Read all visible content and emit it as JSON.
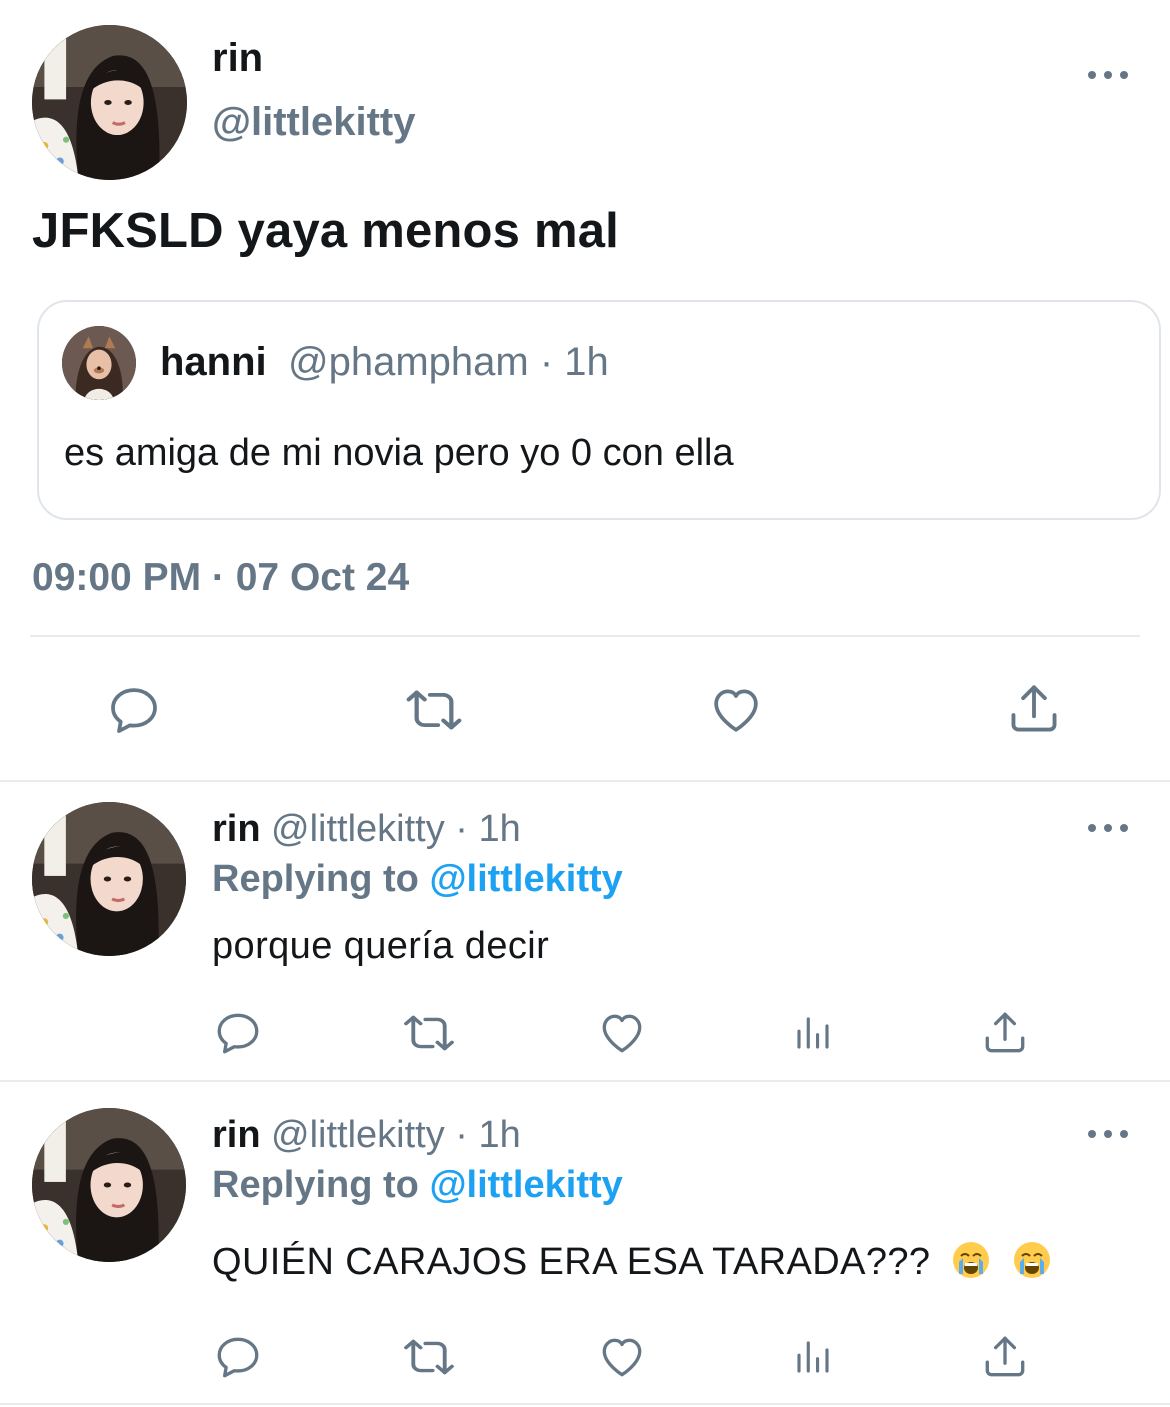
{
  "main_tweet": {
    "name": "rin",
    "handle": "@littlekitty",
    "text": "JFKSLD yaya menos mal",
    "datetime": "09:00 PM · 07 Oct 24",
    "quote": {
      "name": "hanni",
      "handle": "@phampham · 1h",
      "text": "es amiga de mi novia pero yo 0 con ella"
    }
  },
  "replies": [
    {
      "name": "rin",
      "handle": "@littlekitty · 1h",
      "replying_prefix": "Replying to",
      "replying_to": "@littlekitty",
      "text": "porque quería decir"
    },
    {
      "name": "rin",
      "handle": "@littlekitty · 1h",
      "replying_prefix": "Replying to",
      "replying_to": "@littlekitty",
      "text": "QUIÉN CARAJOS ERA ESA TARADA???",
      "emojis": [
        "loudly-crying-face",
        "loudly-crying-face"
      ]
    }
  ],
  "icons": {
    "reply": "reply-icon",
    "retweet": "retweet-icon",
    "like": "heart-icon",
    "share": "share-icon",
    "analytics": "analytics-icon",
    "more": "more-icon"
  },
  "colors": {
    "text": "#14171a",
    "secondary": "#657786",
    "accent": "#1da1f2",
    "divider": "#e6ecf0"
  }
}
